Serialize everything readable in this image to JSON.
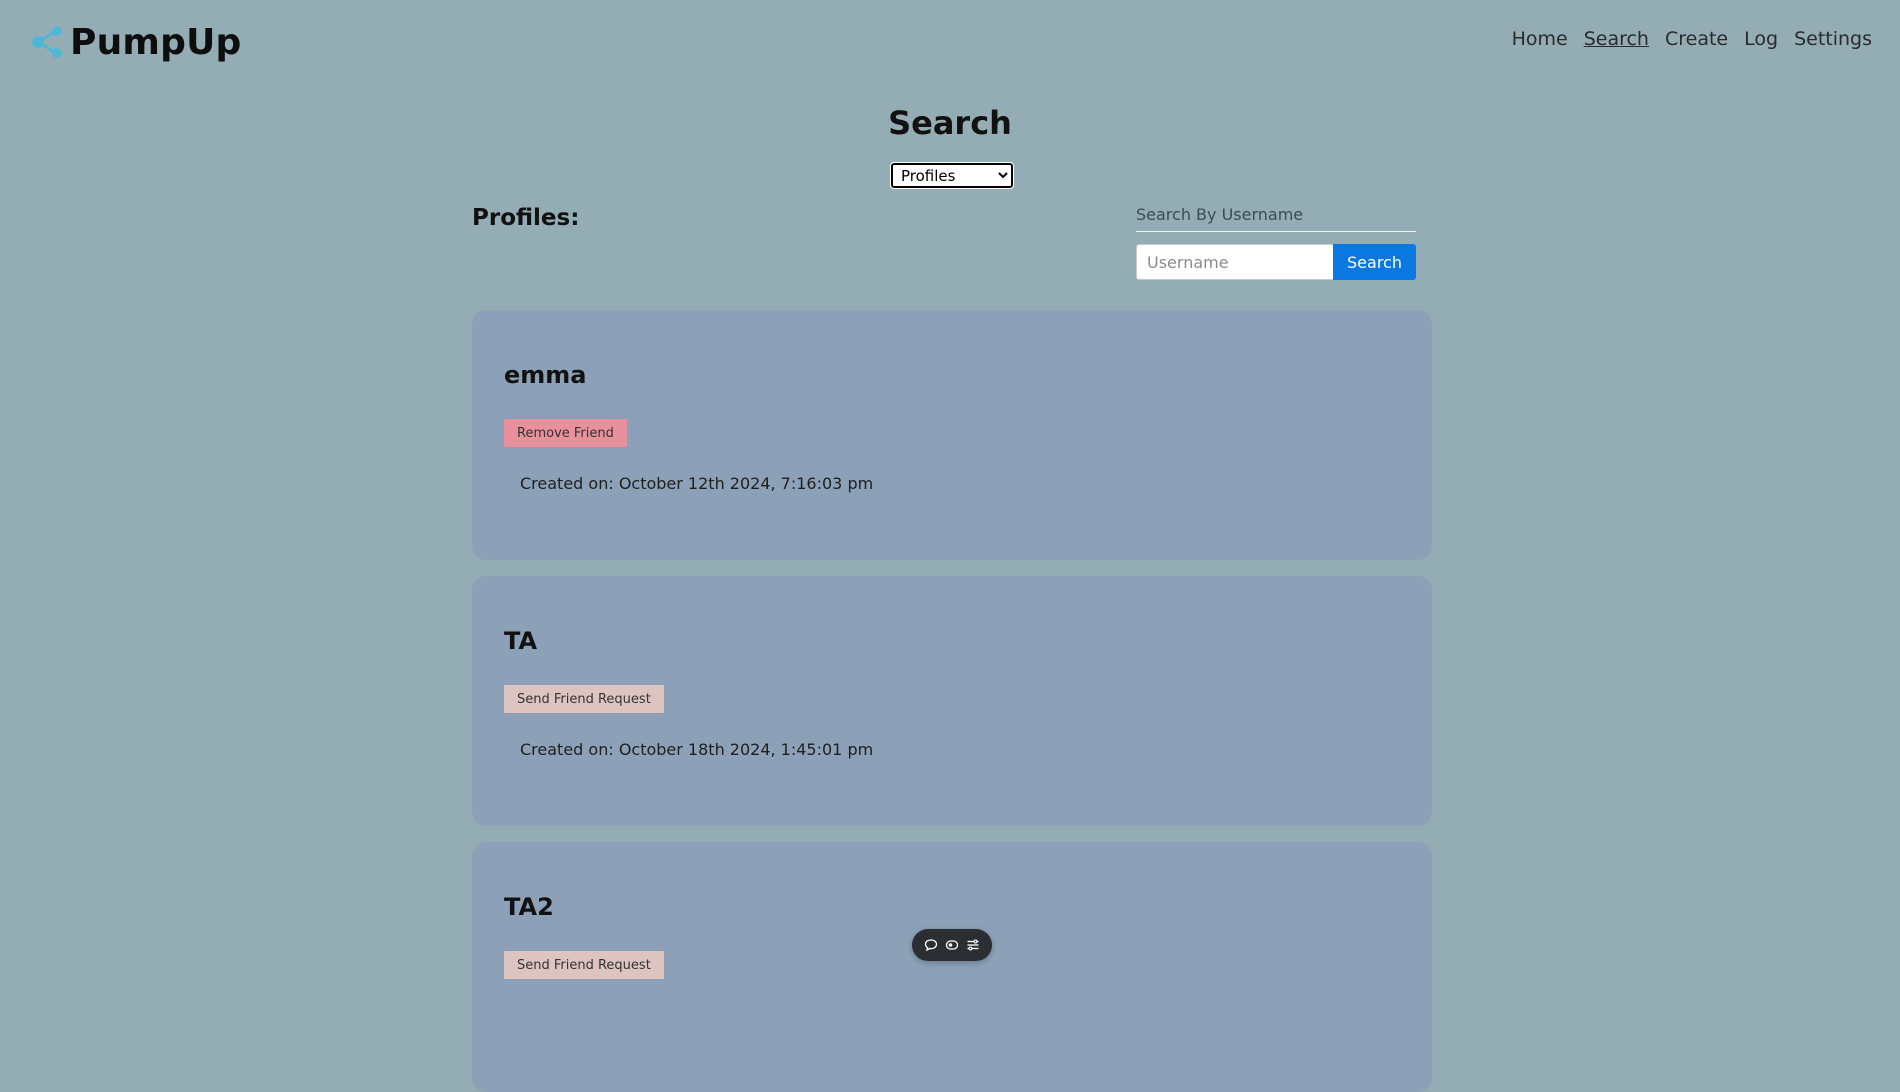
{
  "app": {
    "name": "PumpUp"
  },
  "nav": {
    "items": [
      {
        "label": "Home"
      },
      {
        "label": "Search"
      },
      {
        "label": "Create"
      },
      {
        "label": "Log"
      },
      {
        "label": "Settings"
      }
    ],
    "active": "Search"
  },
  "page": {
    "title": "Search",
    "type_select": {
      "selected": "Profiles",
      "options": [
        "Profiles"
      ]
    },
    "section_heading": "Profiles:"
  },
  "search": {
    "label": "Search By Username",
    "placeholder": "Username",
    "button_label": "Search"
  },
  "profiles": [
    {
      "name": "emma",
      "action_label": "Remove Friend",
      "action_type": "remove",
      "created": "Created on: October 12th 2024, 7:16:03 pm"
    },
    {
      "name": "TA",
      "action_label": "Send Friend Request",
      "action_type": "send",
      "created": "Created on: October 18th 2024, 1:45:01 pm"
    },
    {
      "name": "TA2",
      "action_label": "Send Friend Request",
      "action_type": "send",
      "created": ""
    }
  ],
  "floating_toolbar": {
    "icons": [
      "chat-bubble-icon",
      "eye-toggle-icon",
      "settings-sliders-icon"
    ]
  },
  "colors": {
    "background": "#94adb5",
    "card": "#8ca1b8",
    "accent": "#0a78e0",
    "remove_button": "#e8909b",
    "send_button": "#ddc4c0",
    "logo_accent": "#4fb7d6"
  }
}
